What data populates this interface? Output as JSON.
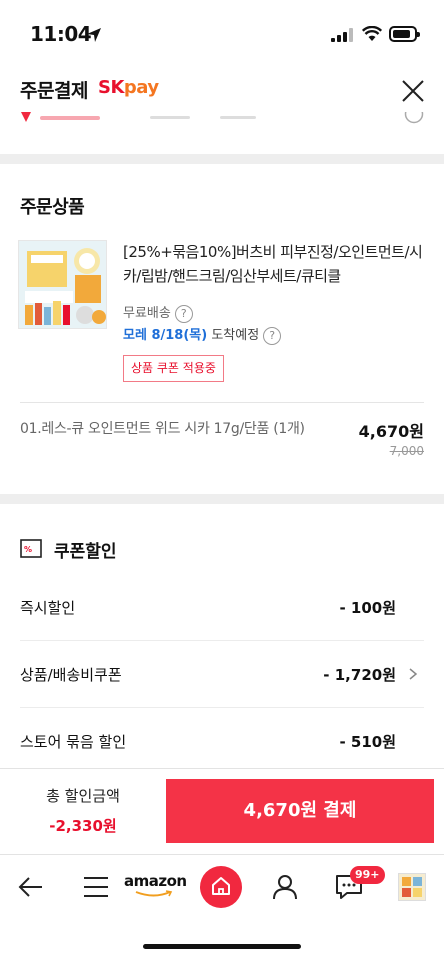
{
  "status_bar": {
    "time": "11:04"
  },
  "header": {
    "title": "주문결제",
    "brand_sk": "SK",
    "brand_pay": "pay"
  },
  "order_items": {
    "title": "주문상품",
    "product": {
      "name": "[25%+묶음10%]버츠비 피부진정/오인트먼트/시카/립밤/핸드크림/임산부세트/큐티클",
      "shipping": "무료배송",
      "arrival_date": "모레 8/18(목)",
      "arrival_suffix": "도착예정",
      "coupon_badge": "상품 쿠폰 적용중"
    },
    "option": {
      "name": "01.레스-큐 오인트먼트 위드 시카 17g/단품 (1개)",
      "price": "4,670원",
      "original_price": "7,000"
    }
  },
  "coupon_discount": {
    "title": "쿠폰할인",
    "rows": [
      {
        "label": "즉시할인",
        "value": "- 100원"
      },
      {
        "label": "상품/배송비쿠폰",
        "value": "- 1,720원"
      },
      {
        "label": "스토어 묶음 할인",
        "value": "- 510원"
      }
    ]
  },
  "summary": {
    "total_label": "총 할인금액",
    "total_value": "-2,330원",
    "pay_button": "4,670원 결제"
  },
  "bottom_nav": {
    "amazon_label": "amazon",
    "chat_badge": "99+"
  },
  "colors": {
    "accent_red": "#f43347",
    "brand_red": "#e8102d",
    "link_blue": "#1f6fd8"
  }
}
